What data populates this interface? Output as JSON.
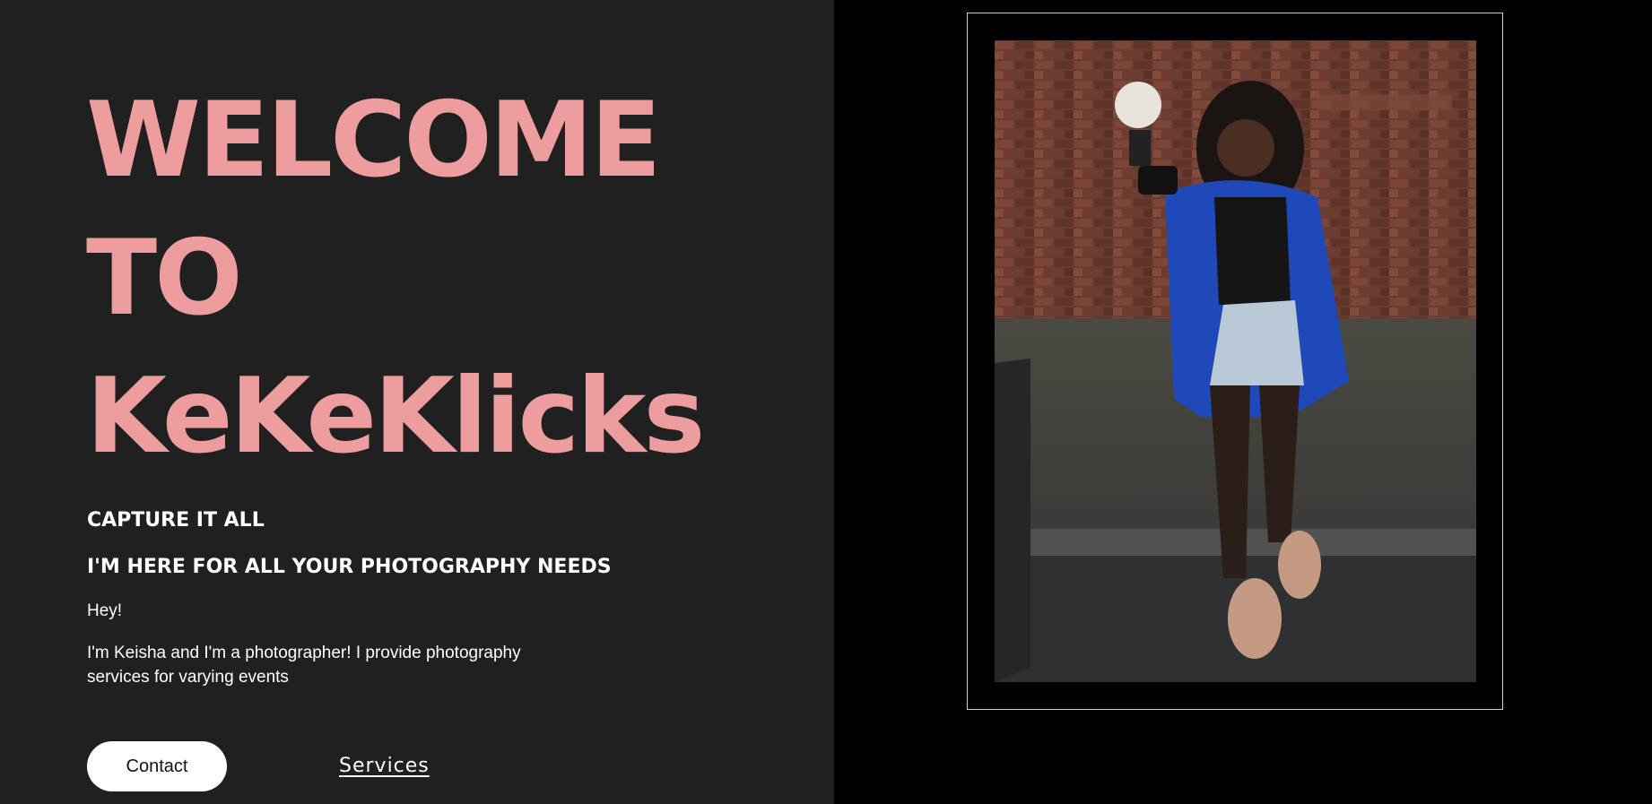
{
  "hero": {
    "title_line1": "WELCOME",
    "title_line2": "TO",
    "title_line3": "KeKeKlicks",
    "accent_color": "#ee9d9e"
  },
  "subheads": {
    "line1": "CAPTURE IT ALL",
    "line2": "I'M HERE FOR ALL YOUR PHOTOGRAPHY NEEDS"
  },
  "intro": {
    "greeting": "Hey!",
    "text": "I'm Keisha and I'm a photographer! I provide photography services for varying events"
  },
  "actions": {
    "contact_label": "Contact",
    "services_label": "Services"
  },
  "photo": {
    "alt": "Photographer holding a camera with flash in front of a brick wall",
    "icon": "portrait-photo"
  }
}
